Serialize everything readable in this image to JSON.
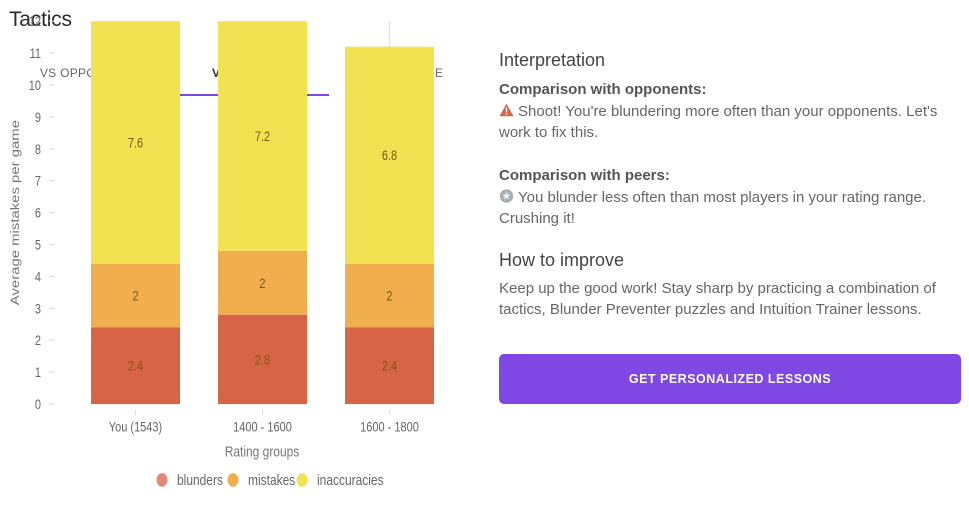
{
  "page": {
    "title": "Tactics"
  },
  "tabs": [
    {
      "label": "VS OPPONENTS",
      "active": false
    },
    {
      "label": "VS GROUPS",
      "active": true
    },
    {
      "label": "PER STAGE",
      "active": false
    }
  ],
  "colors": {
    "accent": "#7f47e3",
    "blunders": "#d76446",
    "mistakes": "#f0ae4e",
    "inaccuracies": "#f2e251",
    "legend_blunders": "#e08a76",
    "warning": "#d76446",
    "star_badge": "#a9b1b5"
  },
  "chart_data": {
    "type": "bar",
    "stacked": true,
    "title": "",
    "xlabel": "Rating groups",
    "ylabel": "Average mistakes per game",
    "ylim": [
      0,
      12
    ],
    "yticks": [
      0,
      1,
      2,
      3,
      4,
      5,
      6,
      7,
      8,
      9,
      10,
      11,
      12
    ],
    "categories": [
      "You (1543)",
      "1400 - 1600",
      "1600 - 1800"
    ],
    "series": [
      {
        "name": "blunders",
        "values": [
          2.4,
          2.8,
          2.4
        ]
      },
      {
        "name": "mistakes",
        "values": [
          2,
          2,
          2
        ]
      },
      {
        "name": "inaccuracies",
        "values": [
          7.6,
          7.2,
          6.8
        ]
      }
    ],
    "data_labels": true,
    "grid": false,
    "legend": "bottom-center",
    "hover_category": "1600 - 1800"
  },
  "interpretation": {
    "heading": "Interpretation",
    "opponents": {
      "title": "Comparison with opponents:",
      "icon": "warning-icon",
      "text": "Shoot! You're blundering more often than your opponents. Let's work to fix this."
    },
    "peers": {
      "title": "Comparison with peers:",
      "icon": "star-badge-icon",
      "text": "You blunder less often than most players in your rating range. Crushing it!"
    }
  },
  "improve": {
    "heading": "How to improve",
    "text": "Keep up the good work! Stay sharp by practicing a combination of tactics, Blunder Preventer puzzles and Intuition Trainer lessons.",
    "cta_label": "GET PERSONALIZED LESSONS"
  }
}
